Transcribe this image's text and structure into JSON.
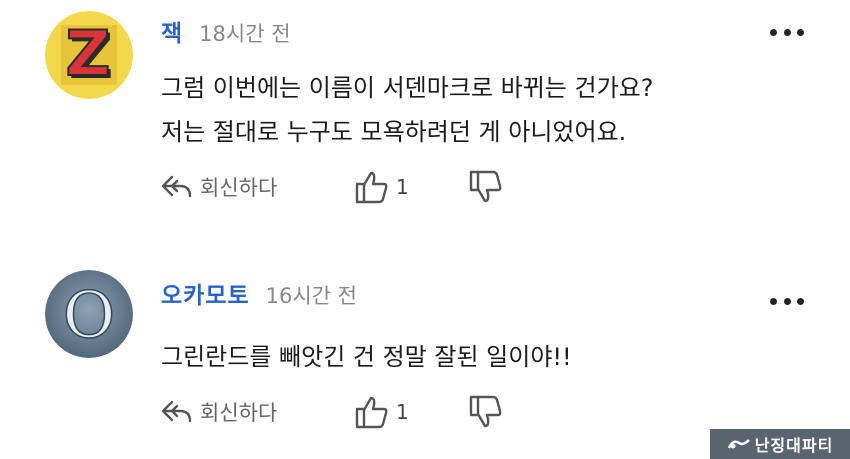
{
  "comments": [
    {
      "author": "잭",
      "time": "18시간 전",
      "avatar_letter": "Z",
      "lines": [
        "그럼 이번에는 이름이 서덴마크로 바뀌는 건가요?",
        "저는 절대로 누구도 모욕하려던 게 아니었어요."
      ],
      "reply_label": "회신하다",
      "like_count": "1"
    },
    {
      "author": "오카모토",
      "time": "16시간 전",
      "avatar_letter": "O",
      "lines": [
        "그린란드를 빼앗긴 건 정말 잘된 일이야!!"
      ],
      "reply_label": "회신하다",
      "like_count": "1"
    }
  ],
  "watermark": "난징대파티",
  "colors": {
    "author": "#2a63c8",
    "time": "#888888",
    "text": "#1c1c1c",
    "icon": "#555555"
  },
  "icons": [
    "more-dots-icon",
    "reply-arrow-icon",
    "thumbs-up-icon",
    "thumbs-down-icon"
  ]
}
